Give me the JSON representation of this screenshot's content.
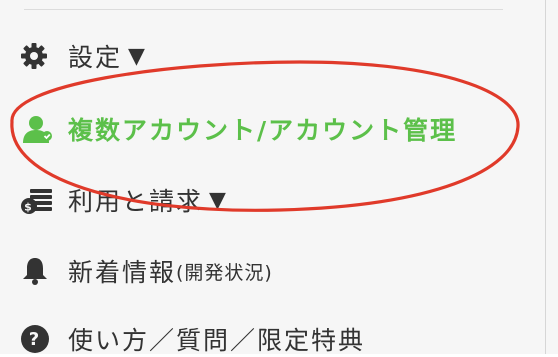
{
  "menu": {
    "settings": {
      "label": "設定",
      "caret": "▼",
      "icon": "gear-icon"
    },
    "account": {
      "label": "複数アカウント/アカウント管理",
      "icon": "user-icon",
      "color": "#5cc04a"
    },
    "billing": {
      "label": "利用と請求",
      "caret": "▼",
      "icon": "billing-icon"
    },
    "news": {
      "label": "新着情報",
      "sub": "(開発状況)",
      "icon": "bell-icon"
    },
    "help": {
      "label": "使い方／質問／限定特典",
      "icon": "question-icon"
    }
  },
  "colors": {
    "highlight_ring": "#e03a2a",
    "accent": "#5cc04a"
  }
}
